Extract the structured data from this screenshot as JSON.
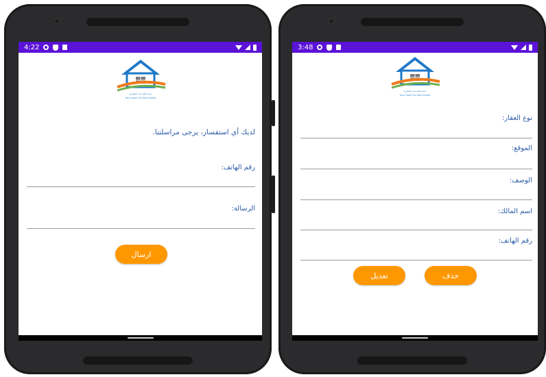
{
  "left_phone": {
    "status": {
      "time": "4:22"
    },
    "inquiry_text": "لديك أي استفسار، يرجى مراسلتنا.",
    "phone_label": "رقم الهاتف:",
    "message_label": "الرسالة:",
    "send_button": "ارسال",
    "logo": {
      "arabic": "سمنا للخدمات العقارية",
      "english": "Your Home To Real Estate"
    }
  },
  "right_phone": {
    "status": {
      "time": "3:48"
    },
    "property_type_label": "نوع العقار:",
    "location_label": "الموقع:",
    "description_label": "الوصف:",
    "owner_name_label": "اسم المالك:",
    "phone_label": "رقم الهاتف:",
    "edit_button": "تعديل",
    "delete_button": "حذف",
    "logo": {
      "arabic": "سمنا للخدمات العقارية",
      "english": "Your Home To Real Estate"
    }
  },
  "colors": {
    "status_bar": "#5b13d8",
    "accent": "#ff9800",
    "label_text": "#2b5aa8",
    "logo_blue": "#1e78c8",
    "logo_orange": "#f07a1a",
    "logo_green": "#6ab04c"
  },
  "icons": [
    "settings-icon",
    "shield-icon",
    "sd-card-icon",
    "wifi-icon",
    "signal-icon",
    "battery-icon",
    "house-logo-icon"
  ]
}
